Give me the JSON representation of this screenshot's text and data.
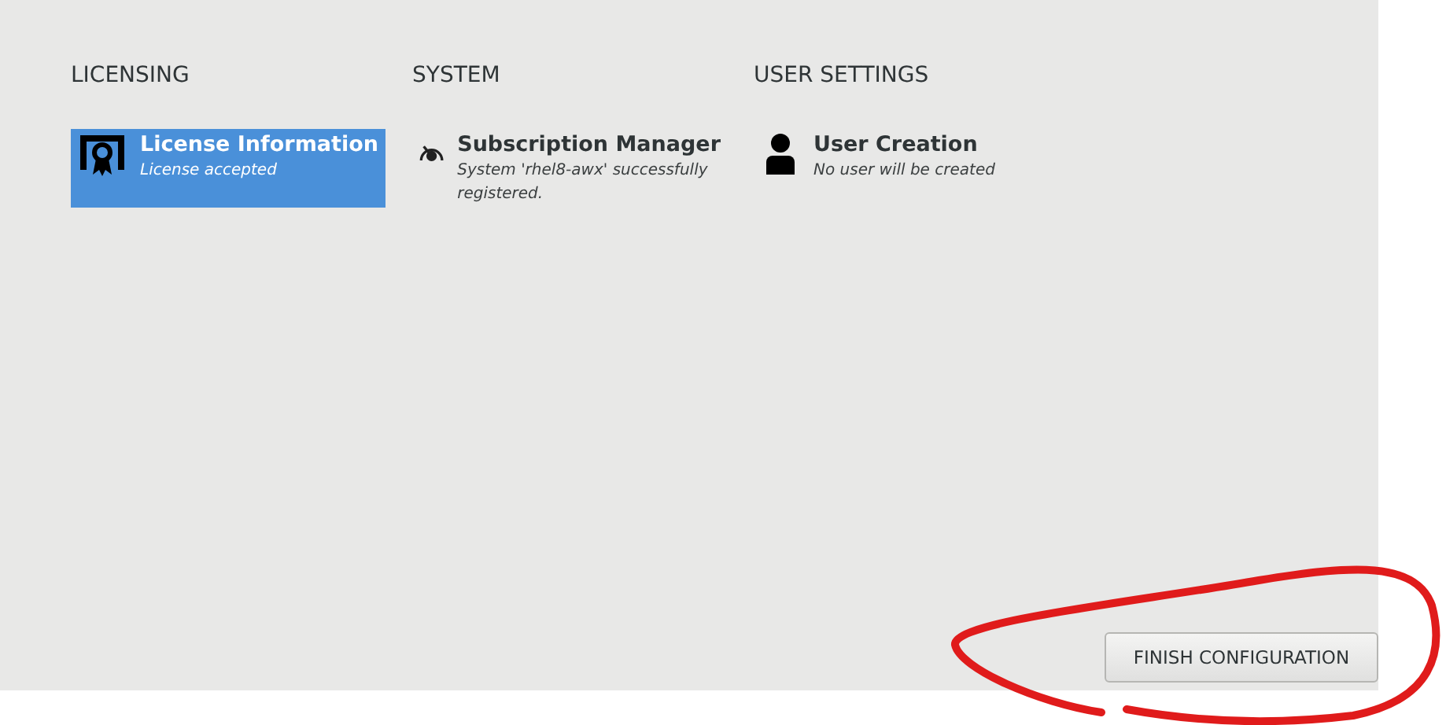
{
  "sections": [
    {
      "title": "LICENSING",
      "items": [
        {
          "kind": "license",
          "title": "License Information",
          "status": "License accepted",
          "selected": true
        }
      ]
    },
    {
      "title": "SYSTEM",
      "items": [
        {
          "kind": "gauge",
          "title": "Subscription Manager",
          "status": "System 'rhel8-awx' successfully registered.",
          "selected": false
        }
      ]
    },
    {
      "title": "USER SETTINGS",
      "items": [
        {
          "kind": "user",
          "title": "User Creation",
          "status": "No user will be created",
          "selected": false
        }
      ]
    }
  ],
  "finish_button": {
    "label": "FINISH CONFIGURATION"
  }
}
